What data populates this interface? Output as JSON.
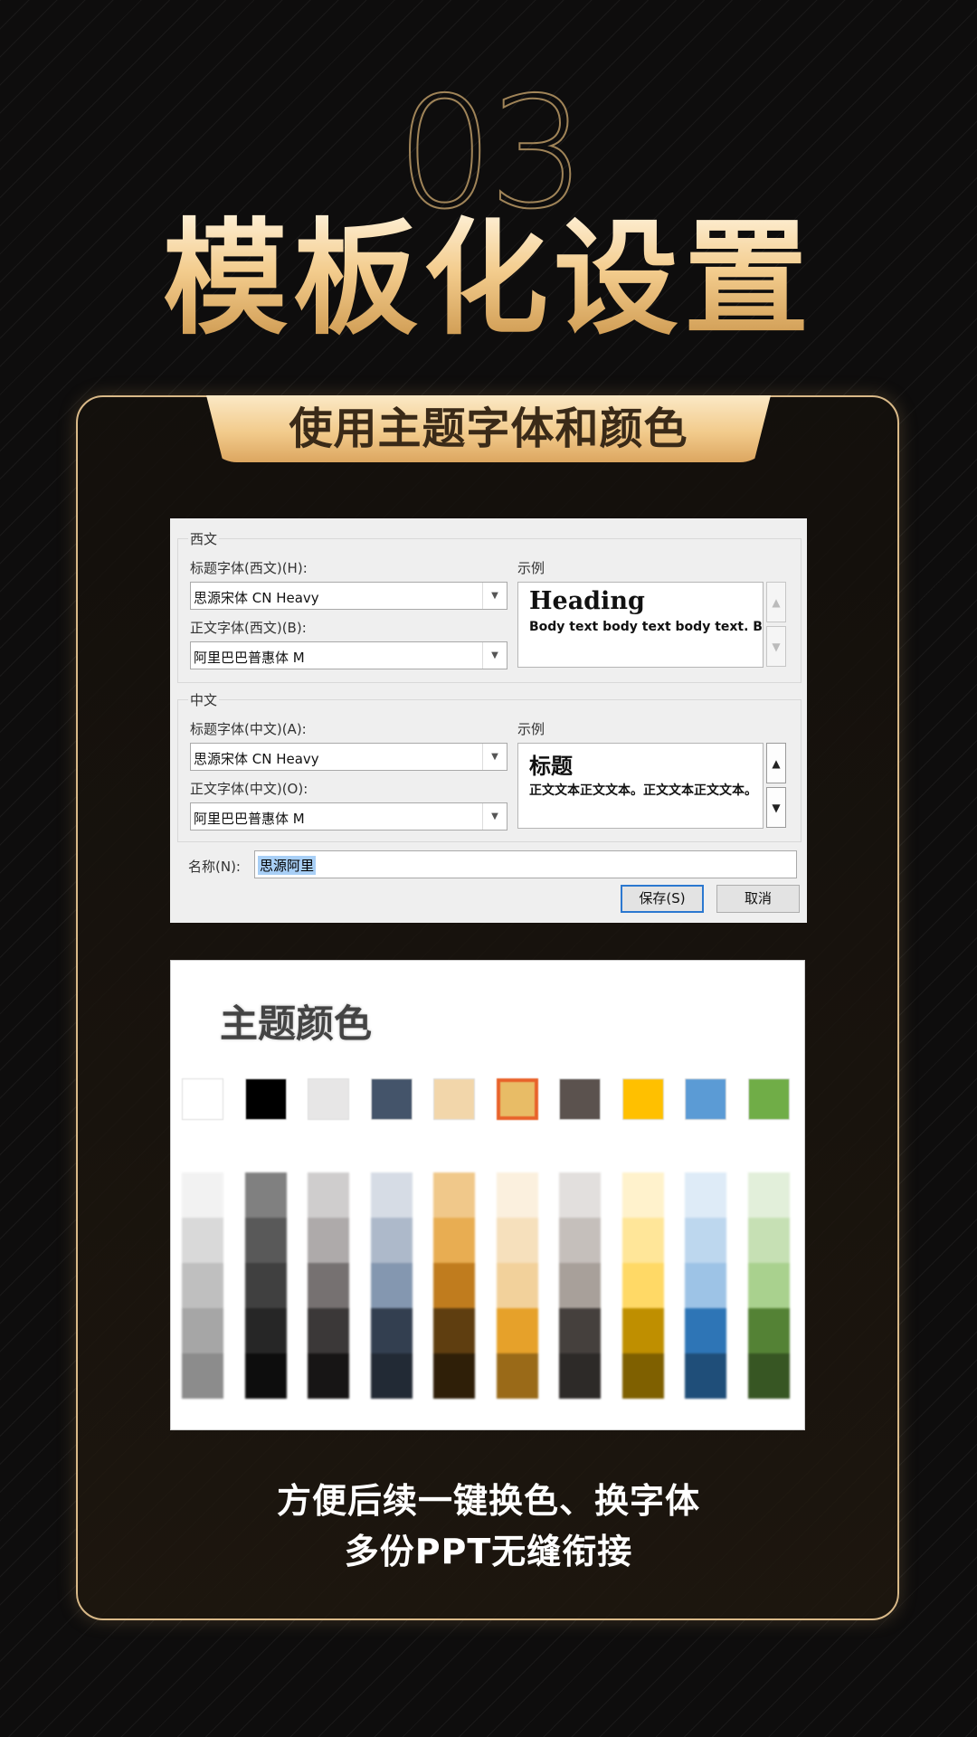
{
  "hero": {
    "number": "03",
    "title": "模板化设置"
  },
  "ribbon": {
    "text": "使用主题字体和颜色"
  },
  "dialog": {
    "western": {
      "group_label": "西文",
      "heading_label": "标题字体(西文)(H):",
      "heading_font": "思源宋体 CN Heavy",
      "body_label": "正文字体(西文)(B):",
      "body_font": "阿里巴巴普惠体 M",
      "sample_label": "示例",
      "sample_heading": "Heading",
      "sample_body": "Body text body text body text. Body text"
    },
    "chinese": {
      "group_label": "中文",
      "heading_label": "标题字体(中文)(A):",
      "heading_font": "思源宋体 CN Heavy",
      "body_label": "正文字体(中文)(O):",
      "body_font": "阿里巴巴普惠体 M",
      "sample_label": "示例",
      "sample_heading": "标题",
      "sample_body": "正文文本正文文本。正文文本正文文本。"
    },
    "name_label": "名称(N):",
    "name_value": "思源阿里",
    "save_label": "保存(S)",
    "cancel_label": "取消"
  },
  "theme_colors": {
    "title": "主题颜色",
    "top_row": [
      "#ffffff",
      "#000000",
      "#e7e6e6",
      "#44546a",
      "#f2d6aa",
      "#e8bc66",
      "#5b524e",
      "#ffc000",
      "#5b9bd5",
      "#70ad47"
    ],
    "selected_index": 5,
    "shades": [
      [
        "#f2f2f2",
        "#d9d9d9",
        "#bfbfbf",
        "#a6a6a6",
        "#8c8c8c"
      ],
      [
        "#808080",
        "#595959",
        "#404040",
        "#262626",
        "#0d0d0d"
      ],
      [
        "#cfcdcd",
        "#aeaaaa",
        "#767171",
        "#3b3838",
        "#171515"
      ],
      [
        "#d6dce5",
        "#adb9ca",
        "#8497b0",
        "#333f50",
        "#222a35"
      ],
      [
        "#f0c88a",
        "#e8ad52",
        "#c07c1e",
        "#5f3e10",
        "#2f1f08"
      ],
      [
        "#fbf0de",
        "#f6e0bc",
        "#f2d19b",
        "#e6a12a",
        "#9a6a18"
      ],
      [
        "#e2dfdd",
        "#c5bfbb",
        "#a8a09a",
        "#45403d",
        "#2d2a28"
      ],
      [
        "#fff2cc",
        "#ffe699",
        "#ffd966",
        "#bf8f00",
        "#7f6000"
      ],
      [
        "#deebf7",
        "#bdd7ee",
        "#9dc3e6",
        "#2e75b6",
        "#1f4e79"
      ],
      [
        "#e2efda",
        "#c6e0b4",
        "#a9d18e",
        "#548235",
        "#375623"
      ]
    ]
  },
  "footer": {
    "line1": "方便后续一键换色、换字体",
    "line2": "多份PPT无缝衔接"
  }
}
